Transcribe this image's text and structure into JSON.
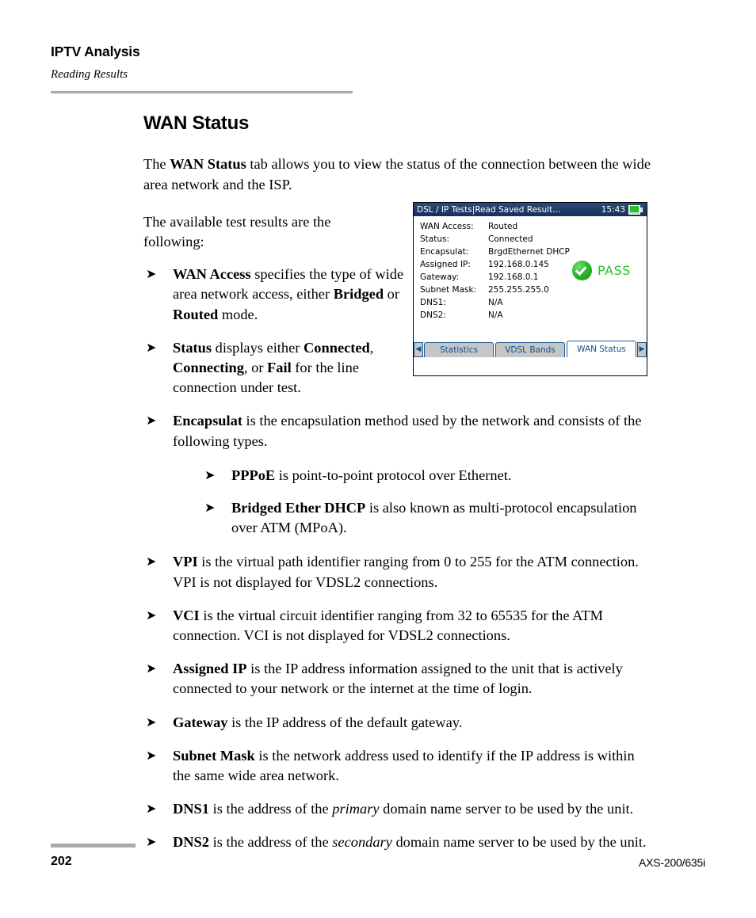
{
  "header": {
    "chapter_title": "IPTV Analysis",
    "section_subtitle": "Reading Results"
  },
  "main": {
    "heading": "WAN Status",
    "intro_paragraph_parts": {
      "p1_a": "The ",
      "p1_b": "WAN Status",
      "p1_c": " tab allows you to view the status of the connection between the wide area network and the ISP."
    },
    "lead_in": "The available test results are the following:",
    "bullets": [
      {
        "term": "WAN Access",
        "text_a": " specifies the type of wide area network access, either ",
        "term_b": "Bridged",
        "text_b": " or ",
        "term_c": "Routed",
        "text_c": " mode."
      },
      {
        "term": "Status",
        "text_a": " displays either ",
        "term_b": "Connected",
        "text_b": ", ",
        "term_c": "Connecting",
        "text_c": ", or ",
        "term_d": "Fail",
        "text_d": " for the line connection under test."
      },
      {
        "term": "Encapsulat",
        "text_a": " is the encapsulation method used by the network and consists of the following types."
      },
      {
        "term": "VPI",
        "text_a": " is the virtual path identifier ranging from 0 to 255 for the ATM connection. VPI is not displayed for VDSL2 connections."
      },
      {
        "term": "VCI",
        "text_a": " is the virtual circuit identifier ranging from 32 to 65535 for the ATM connection. VCI is not displayed for VDSL2 connections."
      },
      {
        "term": "Assigned IP",
        "text_a": " is the IP address information assigned to the unit that is actively connected to your network or the internet at the time of login."
      },
      {
        "term": "Gateway",
        "text_a": " is the IP address of the default gateway."
      },
      {
        "term": "Subnet Mask",
        "text_a": " is the network address used to identify if the IP address is within the same wide area network."
      },
      {
        "term": "DNS1",
        "text_a": " is the address of the ",
        "em_a": "primary",
        "text_b": " domain name server to be used by the unit."
      },
      {
        "term": "DNS2",
        "text_a": " is the address of the ",
        "em_a": "secondary",
        "text_b": " domain name server to be used by the unit."
      }
    ],
    "sub_bullets": [
      {
        "term": "PPPoE",
        "text_a": " is point-to-point protocol over Ethernet."
      },
      {
        "term": "Bridged Ether DHCP",
        "text_a": " is also known as multi-protocol encapsulation over ATM (MPoA)."
      }
    ],
    "bullet_glyph": "➤"
  },
  "device": {
    "titlebar": {
      "title": "DSL / IP Tests|Read Saved Result...",
      "clock": "15:43",
      "battery_icon": "battery-charging-icon"
    },
    "rows": [
      {
        "label": "WAN Access:",
        "value": "Routed"
      },
      {
        "label": "Status:",
        "value": "Connected"
      },
      {
        "label": "Encapsulat:",
        "value": "BrgdEthernet DHCP"
      },
      {
        "label": "Assigned IP:",
        "value": "192.168.0.145"
      },
      {
        "label": "Gateway:",
        "value": "192.168.0.1"
      },
      {
        "label": "Subnet Mask:",
        "value": "255.255.255.0"
      },
      {
        "label": "DNS1:",
        "value": "N/A"
      },
      {
        "label": "DNS2:",
        "value": "N/A"
      }
    ],
    "verdict": {
      "icon": "check-circle-icon",
      "label": "PASS",
      "color": "#27c427"
    },
    "tabbar": {
      "prev_arrow": "◀",
      "next_arrow": "▶",
      "tabs": [
        {
          "label": "Statistics",
          "active": false
        },
        {
          "label": "VDSL Bands",
          "active": false
        },
        {
          "label": "WAN Status",
          "active": true
        }
      ]
    }
  },
  "footer": {
    "page_number": "202",
    "product_name": "AXS-200/635i"
  }
}
